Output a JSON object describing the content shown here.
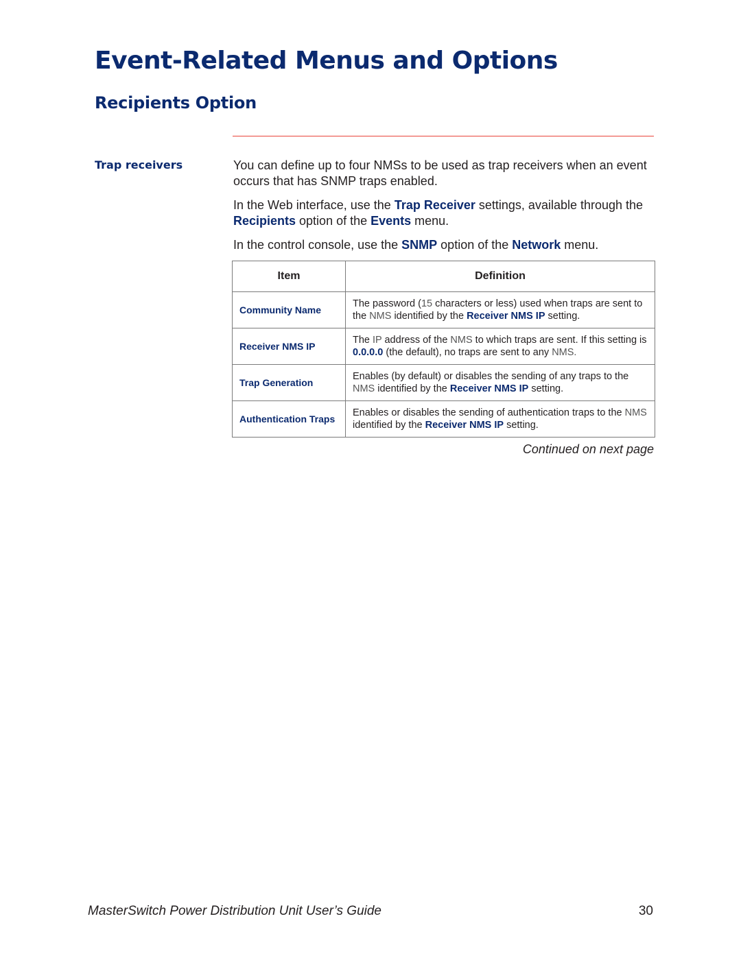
{
  "header": {
    "title": "Event-Related Menus and Options",
    "subtitle": "Recipients Option"
  },
  "section": {
    "label": "Trap receivers",
    "para1": "You can define up to four NMSs to be used as trap receivers when an event occurs that has SNMP traps enabled.",
    "para2": {
      "t1": "In the Web interface, use the ",
      "k1": "Trap Receiver",
      "t2": " settings, available through the ",
      "k2": "Recipients",
      "t3": " option of the ",
      "k3": "Events",
      "t4": " menu."
    },
    "para3": {
      "t1": "In the control console, use the ",
      "k1": "SNMP",
      "t2": " option of the ",
      "k2": "Network",
      "t3": " menu."
    }
  },
  "table": {
    "headers": [
      "Item",
      "Definition"
    ],
    "rows": [
      {
        "item": "Community Name",
        "d1": "The password (",
        "d2": "15",
        "d3": " characters or less) used when traps are sent to the ",
        "d4": "NMS",
        "d5": " identified by the ",
        "d6": "Receiver NMS IP",
        "d7": " setting."
      },
      {
        "item": "Receiver NMS IP",
        "d1": "The ",
        "d2": "IP",
        "d3": " address of the ",
        "d4": "NMS",
        "d5": " to which traps are sent. If this setting is ",
        "d6": "0.0.0.0",
        "d7": " (the default), no traps are sent to any ",
        "d8": "NMS."
      },
      {
        "item": "Trap Generation",
        "d1": "Enables (by default) or disables the sending of any traps to the ",
        "d2": "NMS",
        "d3": " identified by the ",
        "d4": "Receiver NMS IP",
        "d5": " setting."
      },
      {
        "item": "Authentication Traps",
        "d1": "Enables or disables the sending of authentication traps to the ",
        "d2": "NMS",
        "d3": " identified by the ",
        "d4": "Receiver NMS IP",
        "d5": " setting."
      }
    ]
  },
  "continued": "Continued on next page",
  "footer": {
    "title": "MasterSwitch Power Distribution Unit User’s Guide",
    "page": "30"
  },
  "colors": {
    "heading": "#0b2a6f",
    "rule": "#e8433a",
    "table_border": "#7a7a7a"
  }
}
